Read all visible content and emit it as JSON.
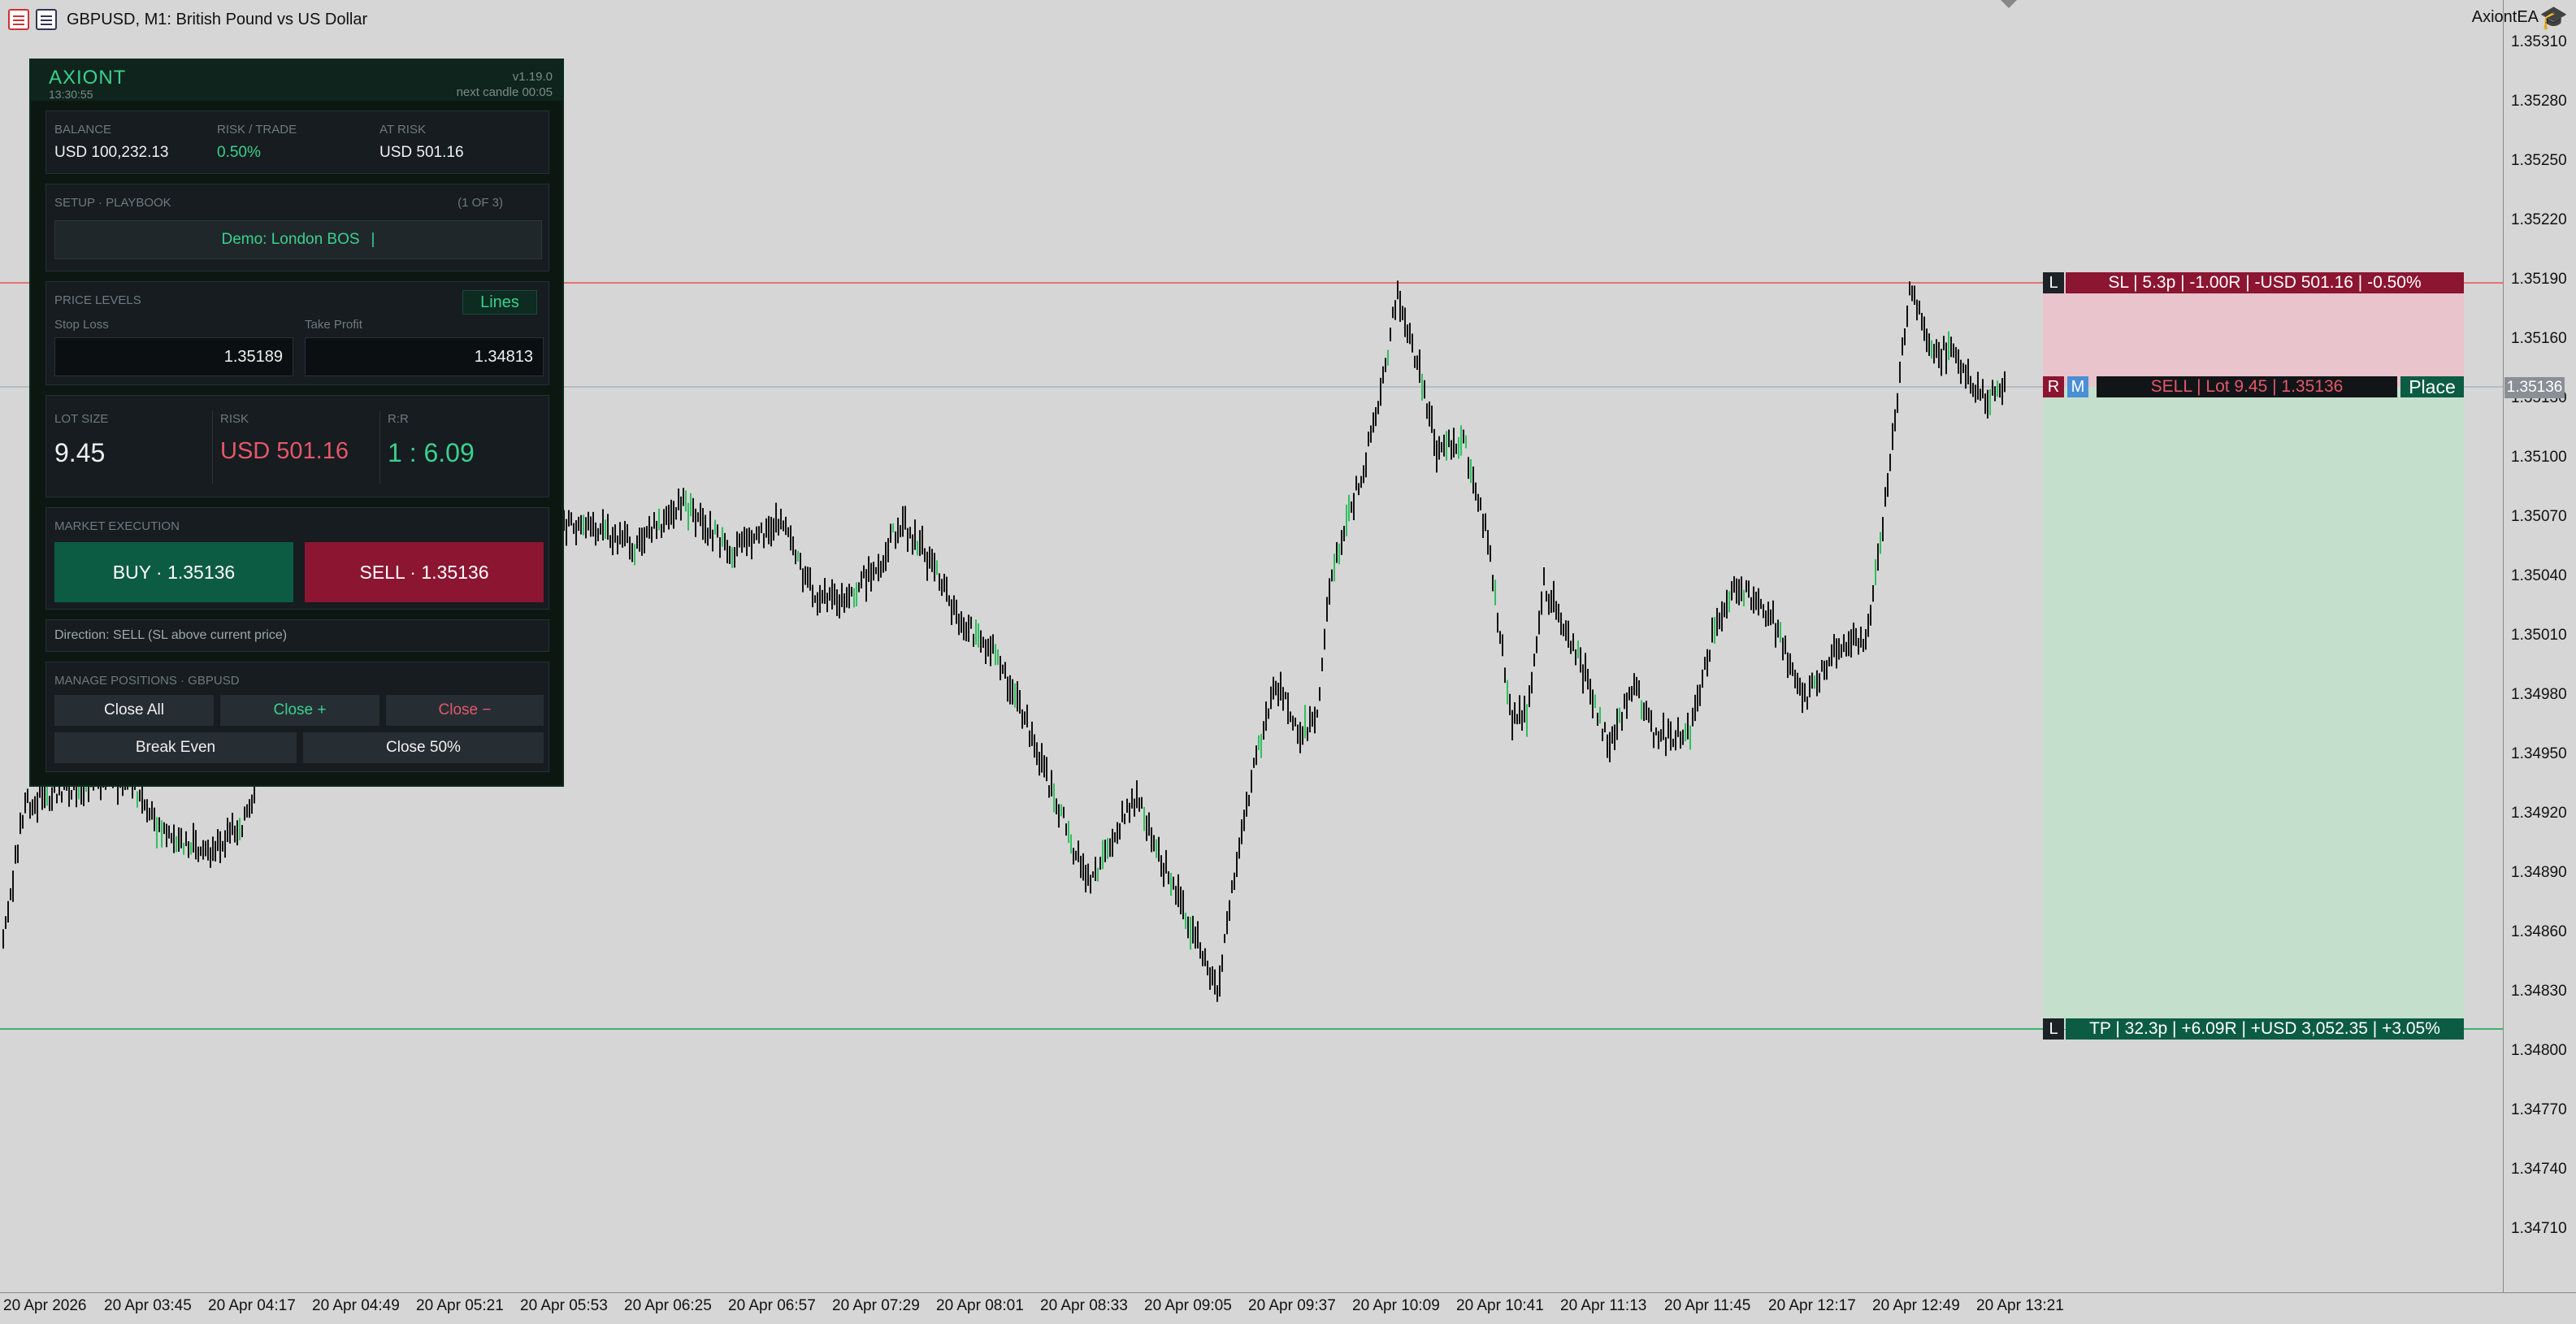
{
  "window": {
    "title": "GBPUSD, M1:  British Pound vs US Dollar",
    "ea_name": "AxiontEA",
    "icons": [
      "chart-list-icon",
      "chart-window-icon",
      "expert-hat-icon"
    ]
  },
  "panel": {
    "name": "AXIONT",
    "time": "13:30:55",
    "version": "v1.19.0",
    "next_candle": "next candle 00:05",
    "account": {
      "balance_label": "BALANCE",
      "balance_value": "USD 100,232.13",
      "risk_label": "RISK / TRADE",
      "risk_value": "0.50%",
      "at_risk_label": "AT RISK",
      "at_risk_value": "USD 501.16"
    },
    "setup": {
      "label": "SETUP · PLAYBOOK",
      "counter": "(1 of 3)",
      "playbook": "Demo: London BOS"
    },
    "levels": {
      "label": "PRICE LEVELS",
      "lines_button": "Lines",
      "sl_label": "Stop Loss",
      "sl_value": "1.35189",
      "tp_label": "Take Profit",
      "tp_value": "1.34813"
    },
    "sizing": {
      "lot_label": "LOT SIZE",
      "lot_value": "9.45",
      "risk_label": "RISK",
      "risk_value": "USD 501.16",
      "rr_label": "R:R",
      "rr_value": "1 : 6.09"
    },
    "execution": {
      "label": "MARKET EXECUTION",
      "buy": "BUY · 1.35136",
      "sell": "SELL · 1.35136"
    },
    "direction": "Direction: SELL (SL above current price)",
    "manage": {
      "label": "MANAGE POSITIONS · GBPUSD",
      "close_all": "Close All",
      "close_plus": "Close +",
      "close_minus": "Close −",
      "break_even": "Break Even",
      "close_half": "Close 50%"
    }
  },
  "order_overlay": {
    "sl_tag": "L",
    "sl_text": "SL | 5.3p | -1.00R | -USD 501.16 | -0.50%",
    "r_tag": "R",
    "m_tag": "M",
    "entry_text": "SELL | Lot 9.45 | 1.35136",
    "place_button": "Place",
    "tp_tag": "L",
    "tp_text": "TP | 32.3p | +6.09R | +USD 3,052.35 | +3.05%",
    "current_price": "1.35136"
  },
  "colors": {
    "chart_bg": "#d6d6d6",
    "sl_line": "#e57373",
    "tp_line": "#3cb371",
    "sl_zone": "#e9c4cc",
    "tp_zone": "#c5dfcd",
    "sl_label_bg": "#8c1532",
    "tp_label_bg": "#0c5c43",
    "accent_green": "#3ad18e",
    "accent_red": "#e4576a"
  },
  "axis": {
    "price_ticks": [
      "1.35310",
      "1.35280",
      "1.35250",
      "1.35220",
      "1.35190",
      "1.35160",
      "1.35130",
      "1.35100",
      "1.35070",
      "1.35040",
      "1.35010",
      "1.34980",
      "1.34950",
      "1.34920",
      "1.34890",
      "1.34860",
      "1.34830",
      "1.34800",
      "1.34770",
      "1.34740",
      "1.34710"
    ],
    "time_ticks": [
      "20 Apr 2026",
      "20 Apr 03:45",
      "20 Apr 04:17",
      "20 Apr 04:49",
      "20 Apr 05:21",
      "20 Apr 05:53",
      "20 Apr 06:25",
      "20 Apr 06:57",
      "20 Apr 07:29",
      "20 Apr 08:01",
      "20 Apr 08:33",
      "20 Apr 09:05",
      "20 Apr 09:37",
      "20 Apr 10:09",
      "20 Apr 10:41",
      "20 Apr 11:13",
      "20 Apr 11:45",
      "20 Apr 12:17",
      "20 Apr 12:49",
      "20 Apr 13:21"
    ]
  }
}
